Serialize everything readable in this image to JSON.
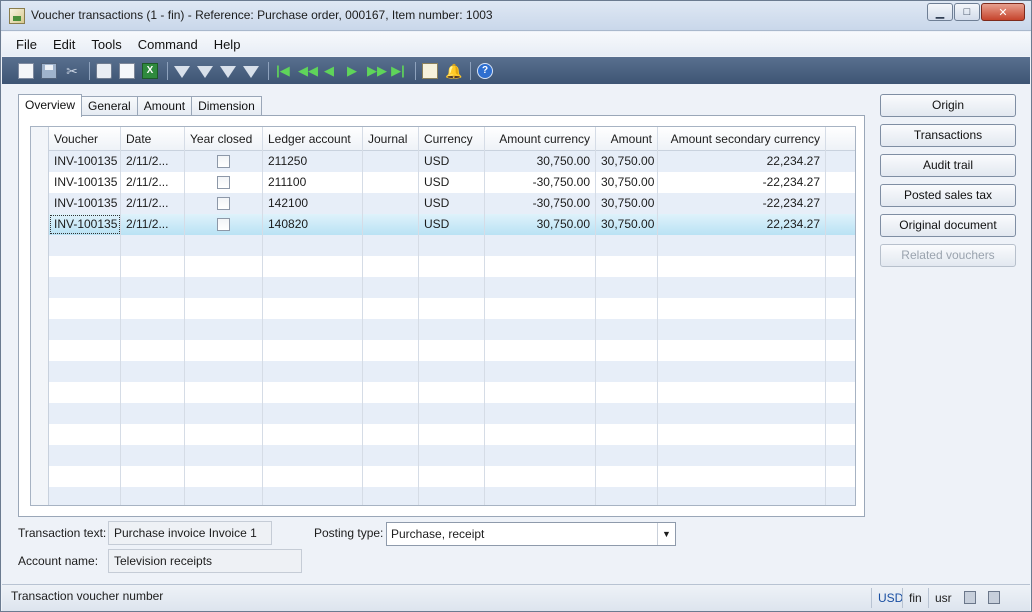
{
  "window": {
    "title": "Voucher transactions (1 - fin) - Reference: Purchase order, 000167, Item number: 1003",
    "min_label": "▁",
    "max_label": "□",
    "close_label": "✕"
  },
  "menu": [
    "File",
    "Edit",
    "Tools",
    "Command",
    "Help"
  ],
  "toolbar_icons": [
    "new-icon",
    "save-icon",
    "delete-icon",
    "print-icon",
    "print-preview-icon",
    "export-excel-icon",
    "filter-by-selection-icon",
    "filter-by-grid-icon",
    "advanced-filter-icon",
    "remove-filter-icon",
    "first-record-icon",
    "previous-page-icon",
    "previous-record-icon",
    "next-record-icon",
    "next-page-icon",
    "last-record-icon",
    "document-handling-icon",
    "alert-icon",
    "help-icon"
  ],
  "tabs": [
    "Overview",
    "General",
    "Amount",
    "Dimension"
  ],
  "grid": {
    "columns": [
      "Voucher",
      "Date",
      "Year closed",
      "Ledger account",
      "Journal",
      "Currency",
      "Amount currency",
      "Amount",
      "Amount secondary currency"
    ],
    "rows": [
      {
        "voucher": "INV-100135",
        "date": "2/11/2...",
        "year_closed": false,
        "ledger_account": "211250",
        "journal": "",
        "currency": "USD",
        "amount_currency": "30,750.00",
        "amount": "30,750.00",
        "amount_secondary": "22,234.27"
      },
      {
        "voucher": "INV-100135",
        "date": "2/11/2...",
        "year_closed": false,
        "ledger_account": "211100",
        "journal": "",
        "currency": "USD",
        "amount_currency": "-30,750.00",
        "amount": "30,750.00",
        "amount_secondary": "-22,234.27"
      },
      {
        "voucher": "INV-100135",
        "date": "2/11/2...",
        "year_closed": false,
        "ledger_account": "142100",
        "journal": "",
        "currency": "USD",
        "amount_currency": "-30,750.00",
        "amount": "30,750.00",
        "amount_secondary": "-22,234.27"
      },
      {
        "voucher": "INV-100135",
        "date": "2/11/2...",
        "year_closed": false,
        "ledger_account": "140820",
        "journal": "",
        "currency": "USD",
        "amount_currency": "30,750.00",
        "amount": "30,750.00",
        "amount_secondary": "22,234.27"
      }
    ],
    "selected_row": 3
  },
  "buttons": {
    "origin": "Origin",
    "transactions": "Transactions",
    "audit_trail": "Audit trail",
    "posted_sales_tax": "Posted sales tax",
    "original_document": "Original document",
    "related_vouchers": "Related vouchers"
  },
  "fields": {
    "transaction_text_label": "Transaction text:",
    "transaction_text_value": "Purchase invoice Invoice 1",
    "posting_type_label": "Posting type:",
    "posting_type_value": "Purchase, receipt",
    "account_name_label": "Account name:",
    "account_name_value": "Television receipts"
  },
  "status": {
    "text": "Transaction voucher number",
    "currency": "USD",
    "company": "fin",
    "layer": "usr"
  },
  "colors": {
    "toolbar": "#4a6183",
    "selected_row": "#c8e9f8",
    "alt_row": "#e7eef8"
  }
}
